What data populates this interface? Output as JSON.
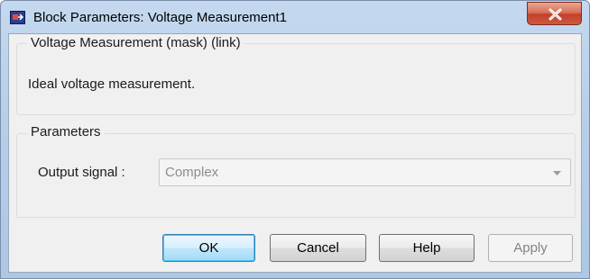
{
  "window": {
    "title": "Block Parameters: Voltage Measurement1",
    "close_icon": "close-x-icon",
    "app_icon": "simulink-block-icon"
  },
  "description_group": {
    "legend": "Voltage Measurement (mask) (link)",
    "text": "Ideal voltage measurement."
  },
  "parameters_group": {
    "legend": "Parameters",
    "output_signal": {
      "label": "Output signal :",
      "value": "Complex",
      "enabled": false
    }
  },
  "buttons": {
    "ok": "OK",
    "cancel": "Cancel",
    "help": "Help",
    "apply": "Apply"
  },
  "colors": {
    "title_bar": "#b9d1ea",
    "close_button": "#c7432e",
    "dialog_background": "#f0f0f0",
    "default_button_border": "#3c7fb1",
    "disabled_text": "#838383"
  }
}
